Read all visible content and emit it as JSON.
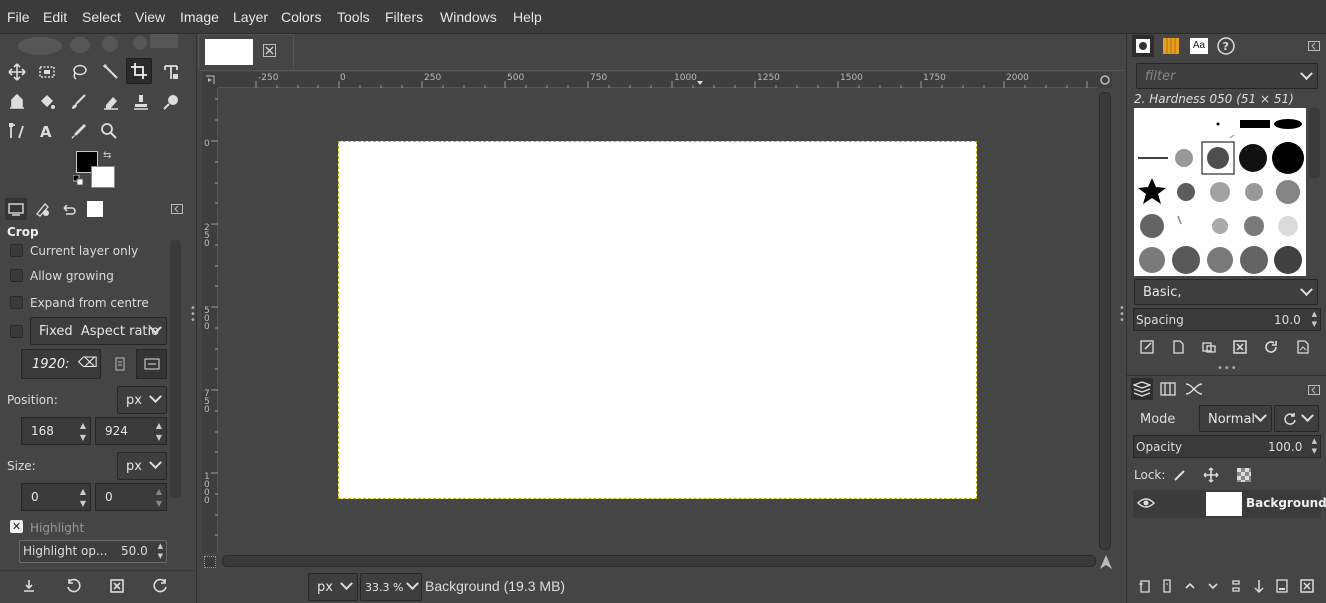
{
  "menu": [
    "File",
    "Edit",
    "Select",
    "View",
    "Image",
    "Layer",
    "Colors",
    "Tools",
    "Filters",
    "Windows",
    "Help"
  ],
  "tool_options": {
    "title": "Crop",
    "current_layer_only": "Current layer only",
    "allow_growing": "Allow growing",
    "expand_from_centre": "Expand from centre",
    "fixed_label": "Fixed",
    "fixed_mode": "Aspect ratio",
    "ratio_value": "1920:",
    "position_label": "Position:",
    "position_unit": "px",
    "position_x": "168",
    "position_y": "924",
    "size_label": "Size:",
    "size_unit": "px",
    "size_w": "0",
    "size_h": "0",
    "highlight": "Highlight",
    "highlight_opacity_label": "Highlight op...",
    "highlight_opacity_value": "50.0"
  },
  "ruler_h": [
    "-250",
    "0",
    "250",
    "500",
    "750",
    "1000",
    "1250",
    "1500",
    "1750",
    "2000"
  ],
  "ruler_v": [
    "0",
    "2\n5\n0",
    "5\n0\n0",
    "7\n5\n0",
    "1\n0\n0\n0"
  ],
  "status": {
    "unit": "px",
    "zoom": "33.3 %",
    "info": "Background (19.3 MB)"
  },
  "brushes": {
    "filter_placeholder": "filter",
    "current": "2. Hardness 050 (51 × 51)",
    "preset": "Basic,",
    "spacing_label": "Spacing",
    "spacing_value": "10.0"
  },
  "layers": {
    "mode_label": "Mode",
    "mode_value": "Normal",
    "opacity_label": "Opacity",
    "opacity_value": "100.0",
    "lock_label": "Lock:",
    "layer_name": "Background"
  },
  "colors": {
    "foreground": "#000000",
    "background": "#ffffff",
    "selection": "#c8b800"
  }
}
